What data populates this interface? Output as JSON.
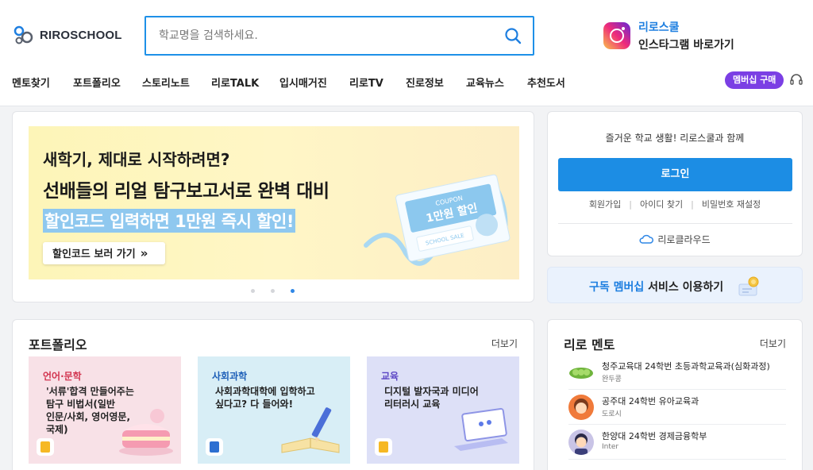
{
  "brand": {
    "name": "RIROSCHOOL"
  },
  "search": {
    "placeholder": "학교명을 검색하세요."
  },
  "instagram": {
    "line1": "리로스쿨",
    "line2": "인스타그램 바로가기"
  },
  "nav": {
    "items": [
      "멘토찾기",
      "포트폴리오",
      "스토리노트",
      "리로TALK",
      "입시매거진",
      "리로TV",
      "진로정보",
      "교육뉴스",
      "추천도서"
    ]
  },
  "membership_button": "멤버십 구매",
  "banner": {
    "line1": "새학기, 제대로 시작하려면?",
    "line2": "선배들의 리얼 탐구보고서로 완벽 대비",
    "line3": "할인코드 입력하면 1만원 즉시 할인!",
    "button": "할인코드 보러 가기",
    "coupon_head": "COUPON",
    "coupon_amount": "1만원 할인",
    "coupon_sale": "SCHOOL SALE",
    "slide_count": 3,
    "active_slide": 3
  },
  "login": {
    "tagline": "즐거운 학교 생활! 리로스쿨과 함께",
    "button": "로그인",
    "links": [
      "회원가입",
      "아이디 찾기",
      "비밀번호 재설정"
    ],
    "cloud": "리로클라우드"
  },
  "subscription": {
    "highlight": "구독 멤버십",
    "rest": " 서비스 이용하기"
  },
  "portfolio": {
    "title": "포트폴리오",
    "more": "더보기",
    "cards": [
      {
        "category": "언어·문학",
        "title": "'서류'합격 만들어주는\n탐구 비법서(일반\n인문/사회, 영어영문,\n국제)"
      },
      {
        "category": "사회과학",
        "title": "사회과학대학에 입학하고\n싶다고? 다 들어와!"
      },
      {
        "category": "교육",
        "title": "디지털 발자국과 미디어\n리터러시 교육"
      }
    ]
  },
  "mentor": {
    "title": "리로 멘토",
    "more": "더보기",
    "items": [
      {
        "school": "청주교육대 24학번 초등과학교육과(심화과정)",
        "name": "완두콩"
      },
      {
        "school": "공주대 24학번 유아교육과",
        "name": "도로시"
      },
      {
        "school": "한양대 24학번 경제금융학부",
        "name": "Inter"
      }
    ]
  },
  "colors": {
    "accent": "#1c8de4",
    "membership": "#7b3fe4",
    "banner_bg": "#fdf5b8"
  }
}
